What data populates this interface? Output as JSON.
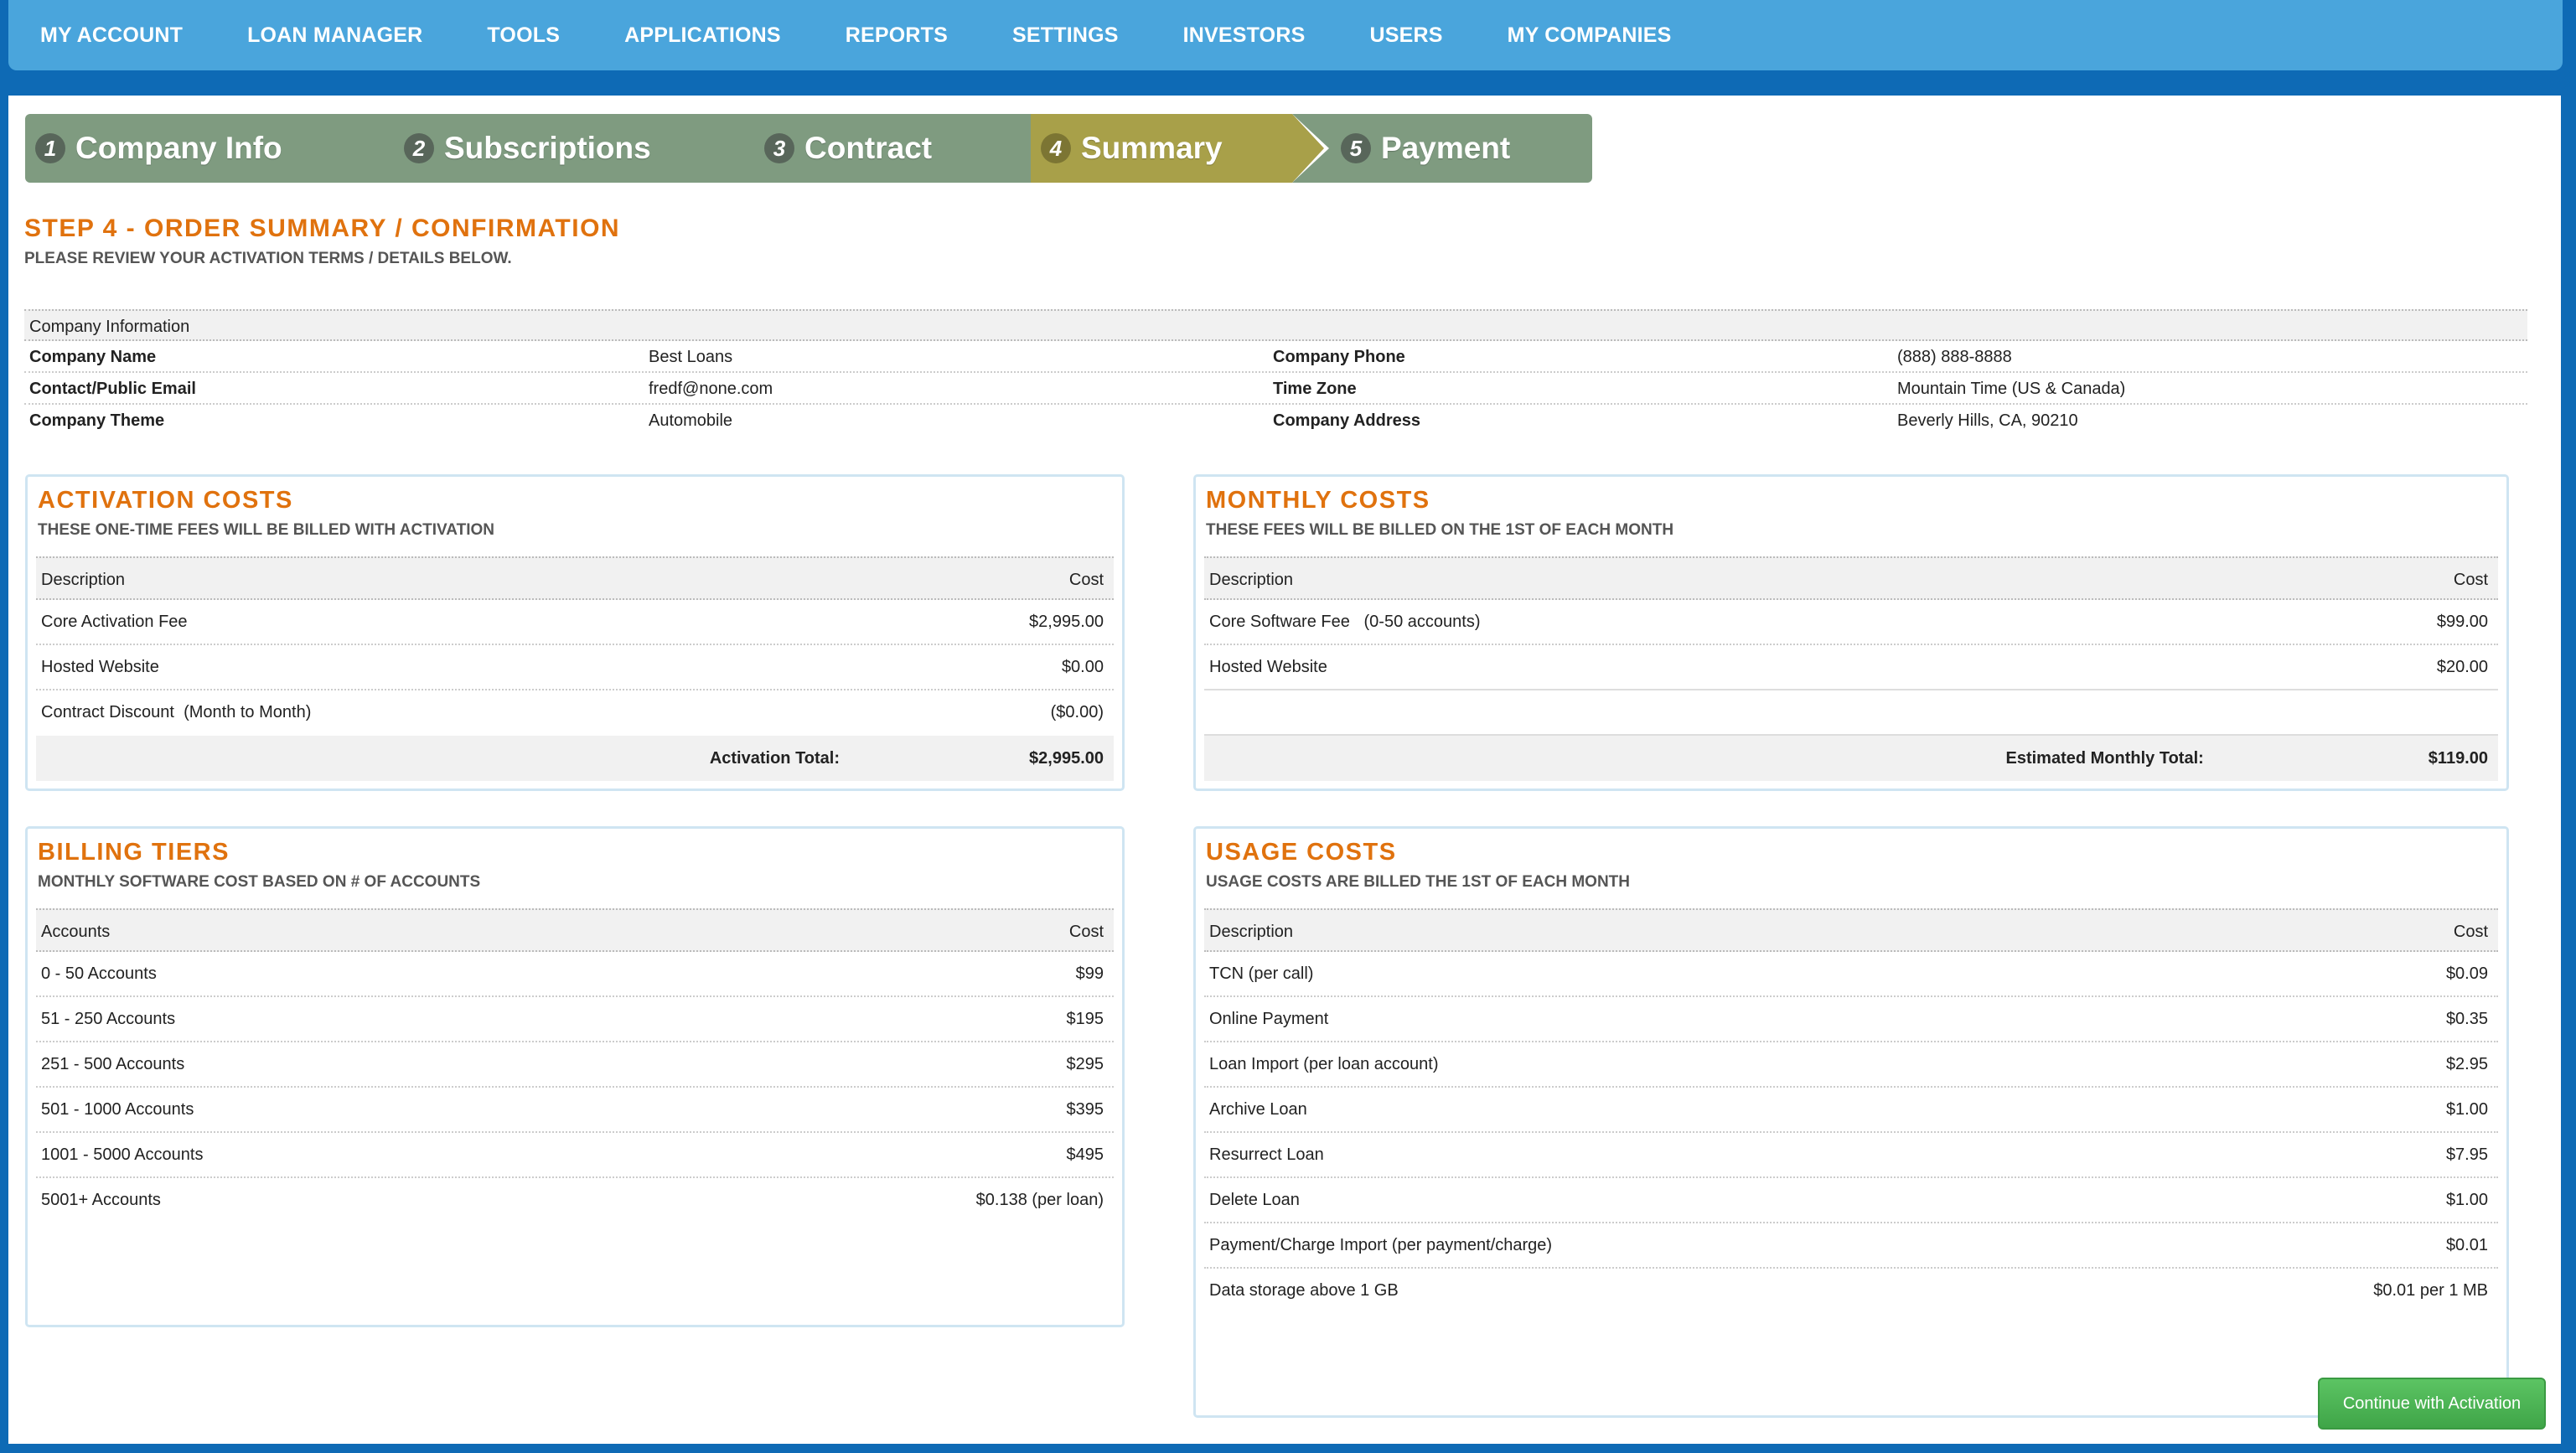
{
  "nav": {
    "items": [
      "MY ACCOUNT",
      "LOAN MANAGER",
      "TOOLS",
      "APPLICATIONS",
      "REPORTS",
      "SETTINGS",
      "INVESTORS",
      "USERS",
      "MY COMPANIES"
    ]
  },
  "wizard": {
    "steps": [
      {
        "num": "1",
        "label": "Company Info"
      },
      {
        "num": "2",
        "label": "Subscriptions"
      },
      {
        "num": "3",
        "label": "Contract"
      },
      {
        "num": "4",
        "label": "Summary"
      },
      {
        "num": "5",
        "label": "Payment"
      }
    ],
    "active_step": 4
  },
  "page": {
    "title": "STEP 4 - ORDER SUMMARY / CONFIRMATION",
    "subtitle": "PLEASE REVIEW YOUR ACTIVATION TERMS / DETAILS BELOW."
  },
  "company": {
    "header": "Company Information",
    "rows": [
      {
        "l1": "Company Name",
        "v1": "Best Loans",
        "l2": "Company Phone",
        "v2": "(888) 888-8888"
      },
      {
        "l1": "Contact/Public Email",
        "v1": "fredf@none.com",
        "l2": "Time Zone",
        "v2": "Mountain Time (US & Canada)"
      },
      {
        "l1": "Company Theme",
        "v1": "Automobile",
        "l2": "Company Address",
        "v2": "Beverly Hills, CA, 90210"
      }
    ]
  },
  "activation": {
    "title": "ACTIVATION COSTS",
    "subtitle": "THESE ONE-TIME FEES WILL BE BILLED WITH ACTIVATION",
    "col_desc": "Description",
    "col_cost": "Cost",
    "rows": [
      {
        "desc": "Core Activation Fee",
        "cost": "$2,995.00"
      },
      {
        "desc": "Hosted Website",
        "cost": "$0.00"
      },
      {
        "desc": "Contract Discount  (Month to Month)",
        "cost": "($0.00)"
      }
    ],
    "total_label": "Activation Total:",
    "total_value": "$2,995.00"
  },
  "monthly": {
    "title": "MONTHLY COSTS",
    "subtitle": "THESE FEES WILL BE BILLED ON THE 1ST OF EACH MONTH",
    "col_desc": "Description",
    "col_cost": "Cost",
    "rows": [
      {
        "desc": "Core Software Fee   (0-50 accounts)",
        "cost": "$99.00"
      },
      {
        "desc": "Hosted Website",
        "cost": "$20.00"
      }
    ],
    "total_label": "Estimated Monthly Total:",
    "total_value": "$119.00"
  },
  "billing": {
    "title": "BILLING TIERS",
    "subtitle": "MONTHLY SOFTWARE COST BASED ON # OF ACCOUNTS",
    "col_desc": "Accounts",
    "col_cost": "Cost",
    "rows": [
      {
        "desc": "0 - 50 Accounts",
        "cost": "$99"
      },
      {
        "desc": "51 - 250 Accounts",
        "cost": "$195"
      },
      {
        "desc": "251 - 500 Accounts",
        "cost": "$295"
      },
      {
        "desc": "501 - 1000 Accounts",
        "cost": "$395"
      },
      {
        "desc": "1001 - 5000 Accounts",
        "cost": "$495"
      },
      {
        "desc": "5001+ Accounts",
        "cost": "$0.138 (per loan)"
      }
    ]
  },
  "usage": {
    "title": "USAGE COSTS",
    "subtitle": "USAGE COSTS ARE BILLED THE 1ST OF EACH MONTH",
    "col_desc": "Description",
    "col_cost": "Cost",
    "rows": [
      {
        "desc": "TCN (per call)",
        "cost": "$0.09"
      },
      {
        "desc": "Online Payment",
        "cost": "$0.35"
      },
      {
        "desc": "Loan Import (per loan account)",
        "cost": "$2.95"
      },
      {
        "desc": "Archive Loan",
        "cost": "$1.00"
      },
      {
        "desc": "Resurrect Loan",
        "cost": "$7.95"
      },
      {
        "desc": "Delete Loan",
        "cost": "$1.00"
      },
      {
        "desc": "Payment/Charge Import (per payment/charge)",
        "cost": "$0.01"
      },
      {
        "desc": "Data storage above 1 GB",
        "cost": "$0.01 per 1 MB"
      }
    ]
  },
  "actions": {
    "continue_label": "Continue with Activation"
  },
  "colors": {
    "nav_bg": "#4aa5dc",
    "page_bg": "#0e6ab5",
    "step_bg": "#7f9b80",
    "step_active_bg": "#a8a049",
    "heading_orange": "#e0720e",
    "button_green": "#4cb553"
  }
}
